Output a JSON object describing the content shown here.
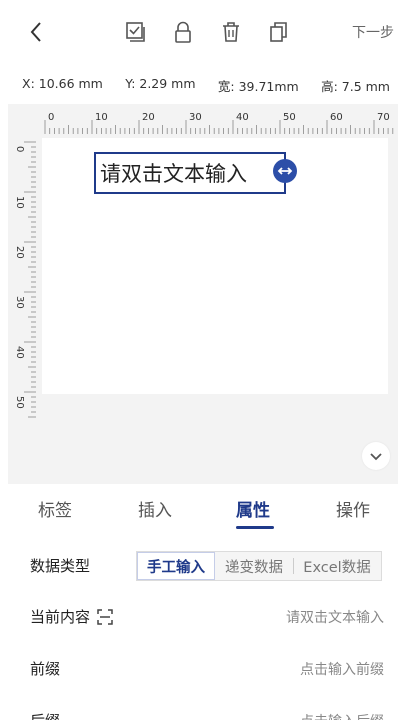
{
  "toolbar": {
    "back_icon": "chevron-left-icon",
    "tools": [
      "checkbox-icon",
      "lock-icon",
      "trash-icon",
      "copy-icon"
    ],
    "next_label": "下一步"
  },
  "coords": {
    "x": "X: 10.66 mm",
    "y": "Y:  2.29  mm",
    "width": "宽: 39.71mm",
    "height": "高:  7.5  mm"
  },
  "ruler": {
    "top_ticks": [
      "0",
      "10",
      "20",
      "30",
      "40",
      "50",
      "60",
      "70"
    ],
    "left_ticks": [
      "0",
      "10",
      "20",
      "30",
      "40",
      "50"
    ]
  },
  "canvas": {
    "text_element": "请双击文本输入",
    "resize_icon": "horizontal-arrows-icon",
    "collapse_icon": "chevron-down-icon"
  },
  "tabs": [
    {
      "label": "标签",
      "active": false
    },
    {
      "label": "插入",
      "active": false
    },
    {
      "label": "属性",
      "active": true
    },
    {
      "label": "操作",
      "active": false
    }
  ],
  "properties": {
    "data_type_label": "数据类型",
    "data_type_options": [
      "手工输入",
      "递变数据",
      "Excel数据"
    ],
    "data_type_selected": "手工输入",
    "content_label": "当前内容",
    "content_icon": "scan-icon",
    "content_value": "请双击文本输入",
    "prefix_label": "前缀",
    "prefix_placeholder": "点击输入前缀",
    "suffix_label": "后缀",
    "suffix_placeholder": "点击输入后缀"
  },
  "colors": {
    "accent": "#1f3a8a",
    "handle": "#2c4ea8",
    "canvas_bg": "#f3f3f3"
  }
}
